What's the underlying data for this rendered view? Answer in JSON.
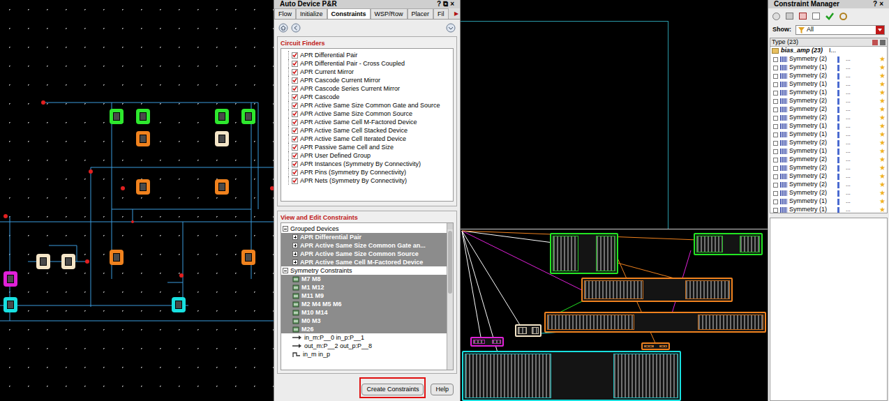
{
  "schematic": {
    "devices": [
      {
        "color": "#2ee82e"
      },
      {
        "color": "#2ee82e"
      },
      {
        "color": "#2ee82e"
      },
      {
        "color": "#2ee82e"
      },
      {
        "color": "#f0821e"
      },
      {
        "color": "#f5e6c8"
      },
      {
        "color": "#f0821e"
      },
      {
        "color": "#f0821e"
      },
      {
        "color": "#f0821e"
      },
      {
        "color": "#f0821e"
      },
      {
        "color": "#f5e6c8"
      },
      {
        "color": "#f5e6c8"
      },
      {
        "color": "#e020d8"
      },
      {
        "color": "#18e0e0"
      },
      {
        "color": "#18e0e0"
      }
    ]
  },
  "auto_device": {
    "title": "Auto Device P&R",
    "title_buttons": [
      "?",
      "⧉",
      "×"
    ],
    "tabs": [
      {
        "label": "Flow",
        "selected": false
      },
      {
        "label": "Initialize",
        "selected": false
      },
      {
        "label": "Constraints",
        "selected": true
      },
      {
        "label": "WSP/Row",
        "selected": false
      },
      {
        "label": "Placer",
        "selected": false
      },
      {
        "label": "Fil",
        "selected": false
      }
    ],
    "tab_scroll": "▶",
    "circuit_finders": {
      "title": "Circuit Finders",
      "items": [
        {
          "label": "APR Differential Pair",
          "checked": true
        },
        {
          "label": "APR Differential Pair - Cross Coupled",
          "checked": true
        },
        {
          "label": "APR Current Mirror",
          "checked": true
        },
        {
          "label": "APR Cascode Current Mirror",
          "checked": true
        },
        {
          "label": "APR Cascode Series Current Mirror",
          "checked": true
        },
        {
          "label": "APR Cascode",
          "checked": true
        },
        {
          "label": "APR Active Same Size Common Gate and Source",
          "checked": true
        },
        {
          "label": "APR Active Same Size Common Source",
          "checked": true
        },
        {
          "label": "APR Active Same Cell M-Factored Device",
          "checked": true
        },
        {
          "label": "APR Active Same Cell Stacked Device",
          "checked": true
        },
        {
          "label": "APR Active Same Cell Iterated Device",
          "checked": true
        },
        {
          "label": "APR Passive Same Cell and Size",
          "checked": true
        },
        {
          "label": "APR User Defined Group",
          "checked": true
        },
        {
          "label": "APR Instances (Symmetry By Connectivity)",
          "checked": true
        },
        {
          "label": "APR Pins (Symmetry By Connectivity)",
          "checked": true
        },
        {
          "label": "APR Nets (Symmetry By Connectivity)",
          "checked": true
        }
      ]
    },
    "view_edit": {
      "title": "View and Edit Constraints",
      "tree": [
        {
          "label": "Grouped Devices",
          "kind": "category",
          "expanded": true,
          "selected": false
        },
        {
          "label": "APR Differential Pair",
          "kind": "group",
          "expanded": false,
          "selected": true
        },
        {
          "label": "APR Active Same Size Common Gate an...",
          "kind": "group",
          "expanded": false,
          "selected": true
        },
        {
          "label": "APR Active Same Size Common Source",
          "kind": "group",
          "expanded": false,
          "selected": true
        },
        {
          "label": "APR Active Same Cell M-Factored Device",
          "kind": "group",
          "expanded": false,
          "selected": true
        },
        {
          "label": "Symmetry Constraints",
          "kind": "category",
          "expanded": true,
          "selected": false
        },
        {
          "label": "M7 M8",
          "kind": "device",
          "expanded": false,
          "selected": true
        },
        {
          "label": "M1 M12",
          "kind": "device",
          "expanded": false,
          "selected": true
        },
        {
          "label": "M11 M9",
          "kind": "device",
          "expanded": false,
          "selected": true
        },
        {
          "label": "M2 M4 M5 M6",
          "kind": "device",
          "expanded": false,
          "selected": true
        },
        {
          "label": "M10 M14",
          "kind": "device",
          "expanded": false,
          "selected": true
        },
        {
          "label": "M0 M3",
          "kind": "device",
          "expanded": false,
          "selected": true
        },
        {
          "label": "M26",
          "kind": "device",
          "expanded": false,
          "selected": true
        },
        {
          "label": "in_m:P__0 in_p:P__1",
          "kind": "pin",
          "expanded": false,
          "selected": false
        },
        {
          "label": "out_m:P__2 out_p:P__8",
          "kind": "pin",
          "expanded": false,
          "selected": false
        },
        {
          "label": "in_m in_p",
          "kind": "net",
          "expanded": false,
          "selected": false
        }
      ]
    },
    "buttons": [
      {
        "label": "Create Constraints",
        "highlighted": true
      },
      {
        "label": "Help",
        "highlighted": false
      }
    ]
  },
  "layout": {
    "blocks": [
      {
        "color": "#22e622"
      },
      {
        "color": "#22e622"
      },
      {
        "color": "#f0821e"
      },
      {
        "color": "#f0821e"
      },
      {
        "color": "#f5e6c8"
      },
      {
        "color": "#e020d8"
      },
      {
        "color": "#f0821e"
      },
      {
        "color": "#18e0e0"
      }
    ]
  },
  "constraint_manager": {
    "title": "Constraint Manager",
    "title_buttons": [
      "?",
      "×"
    ],
    "show_label": "Show:",
    "filter": "All",
    "column": "Type (23)",
    "root": {
      "label": "bias_amp (23)",
      "extra": "I..."
    },
    "rows": [
      "Symmetry (2)",
      "Symmetry (1)",
      "Symmetry (2)",
      "Symmetry (1)",
      "Symmetry (1)",
      "Symmetry (2)",
      "Symmetry (2)",
      "Symmetry (2)",
      "Symmetry (1)",
      "Symmetry (1)",
      "Symmetry (2)",
      "Symmetry (1)",
      "Symmetry (2)",
      "Symmetry (2)",
      "Symmetry (2)",
      "Symmetry (2)",
      "Symmetry (2)",
      "Symmetry (1)",
      "Symmetry (1)"
    ],
    "row_extra": "..."
  }
}
